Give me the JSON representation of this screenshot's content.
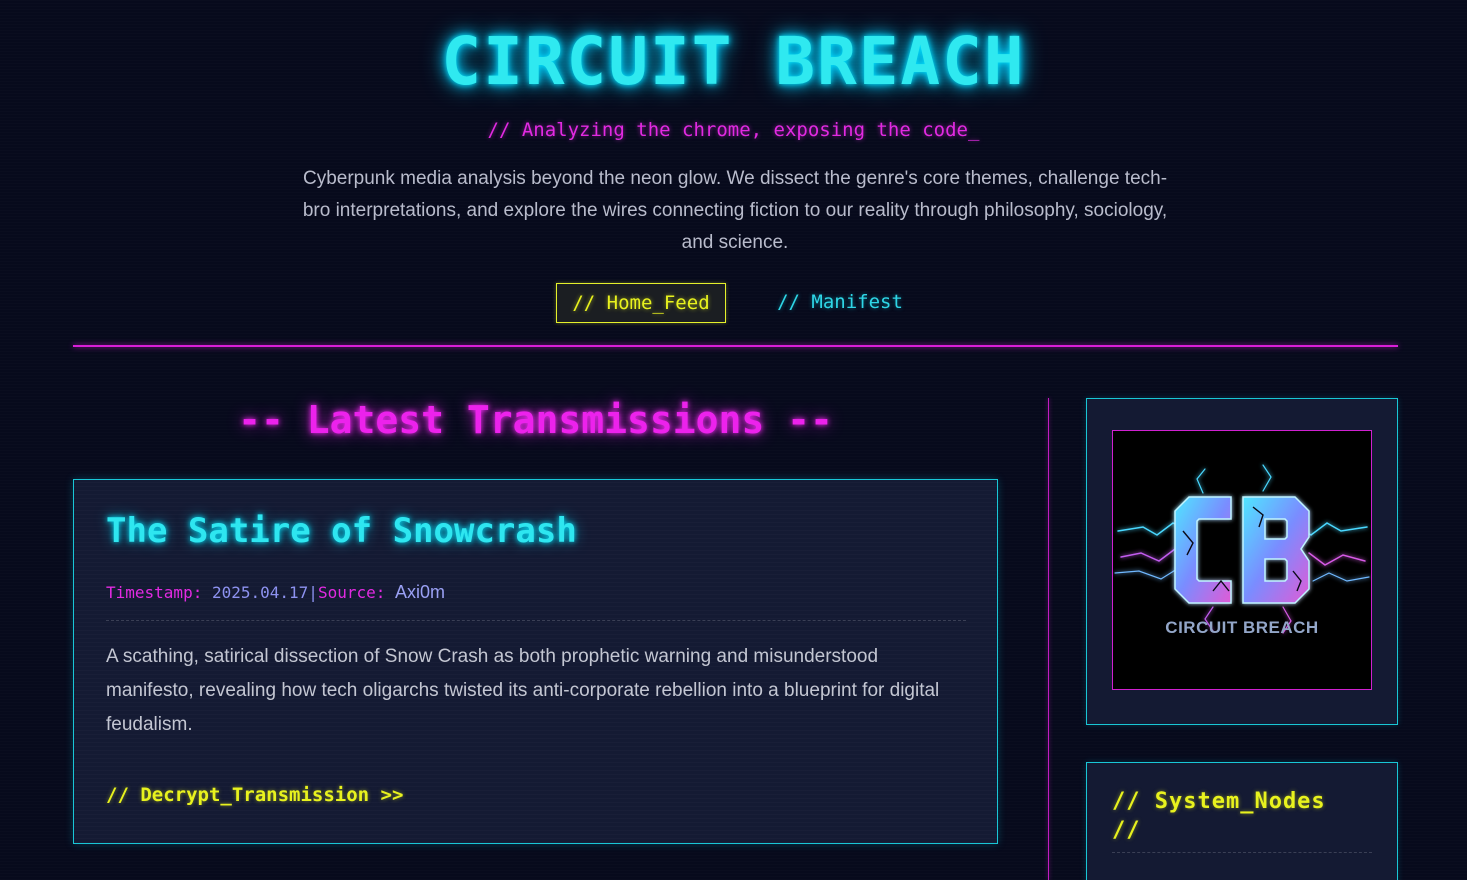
{
  "header": {
    "title": "CIRCUIT BREACH",
    "tagline": "// Analyzing the chrome, exposing the code_",
    "intro": "Cyberpunk media analysis beyond the neon glow. We dissect the genre's core themes, challenge tech-bro interpretations, and explore the wires connecting fiction to our reality through philosophy, sociology, and science."
  },
  "nav": {
    "items": [
      {
        "label": "// Home_Feed",
        "active": true
      },
      {
        "label": "// Manifest",
        "active": false
      }
    ]
  },
  "main": {
    "section_heading": "-- Latest Transmissions --",
    "posts": [
      {
        "title": "The Satire of Snowcrash",
        "timestamp_label": "Timestamp:",
        "timestamp": "2025.04.17",
        "separator": "|",
        "source_label": "Source:",
        "source": "Axi0m",
        "excerpt": "A scathing, satirical dissection of Snow Crash as both prophetic warning and misunderstood manifesto, revealing how tech oligarchs twisted its anti-corporate rebellion into a blueprint for digital feudalism.",
        "link_label": "// Decrypt_Transmission >>"
      }
    ]
  },
  "sidebar": {
    "logo": {
      "monogram": "CB",
      "caption": "CIRCUIT BREACH"
    },
    "nodes": {
      "title": "// System_Nodes //"
    }
  },
  "colors": {
    "background": "#070a1c",
    "cyan_accent": "#2fe9f0",
    "magenta_accent": "#e22ae2",
    "yellow_accent": "#e8f21e",
    "panel": "#141a33"
  },
  "icons": {
    "logo": "cb-lightning-logo"
  }
}
